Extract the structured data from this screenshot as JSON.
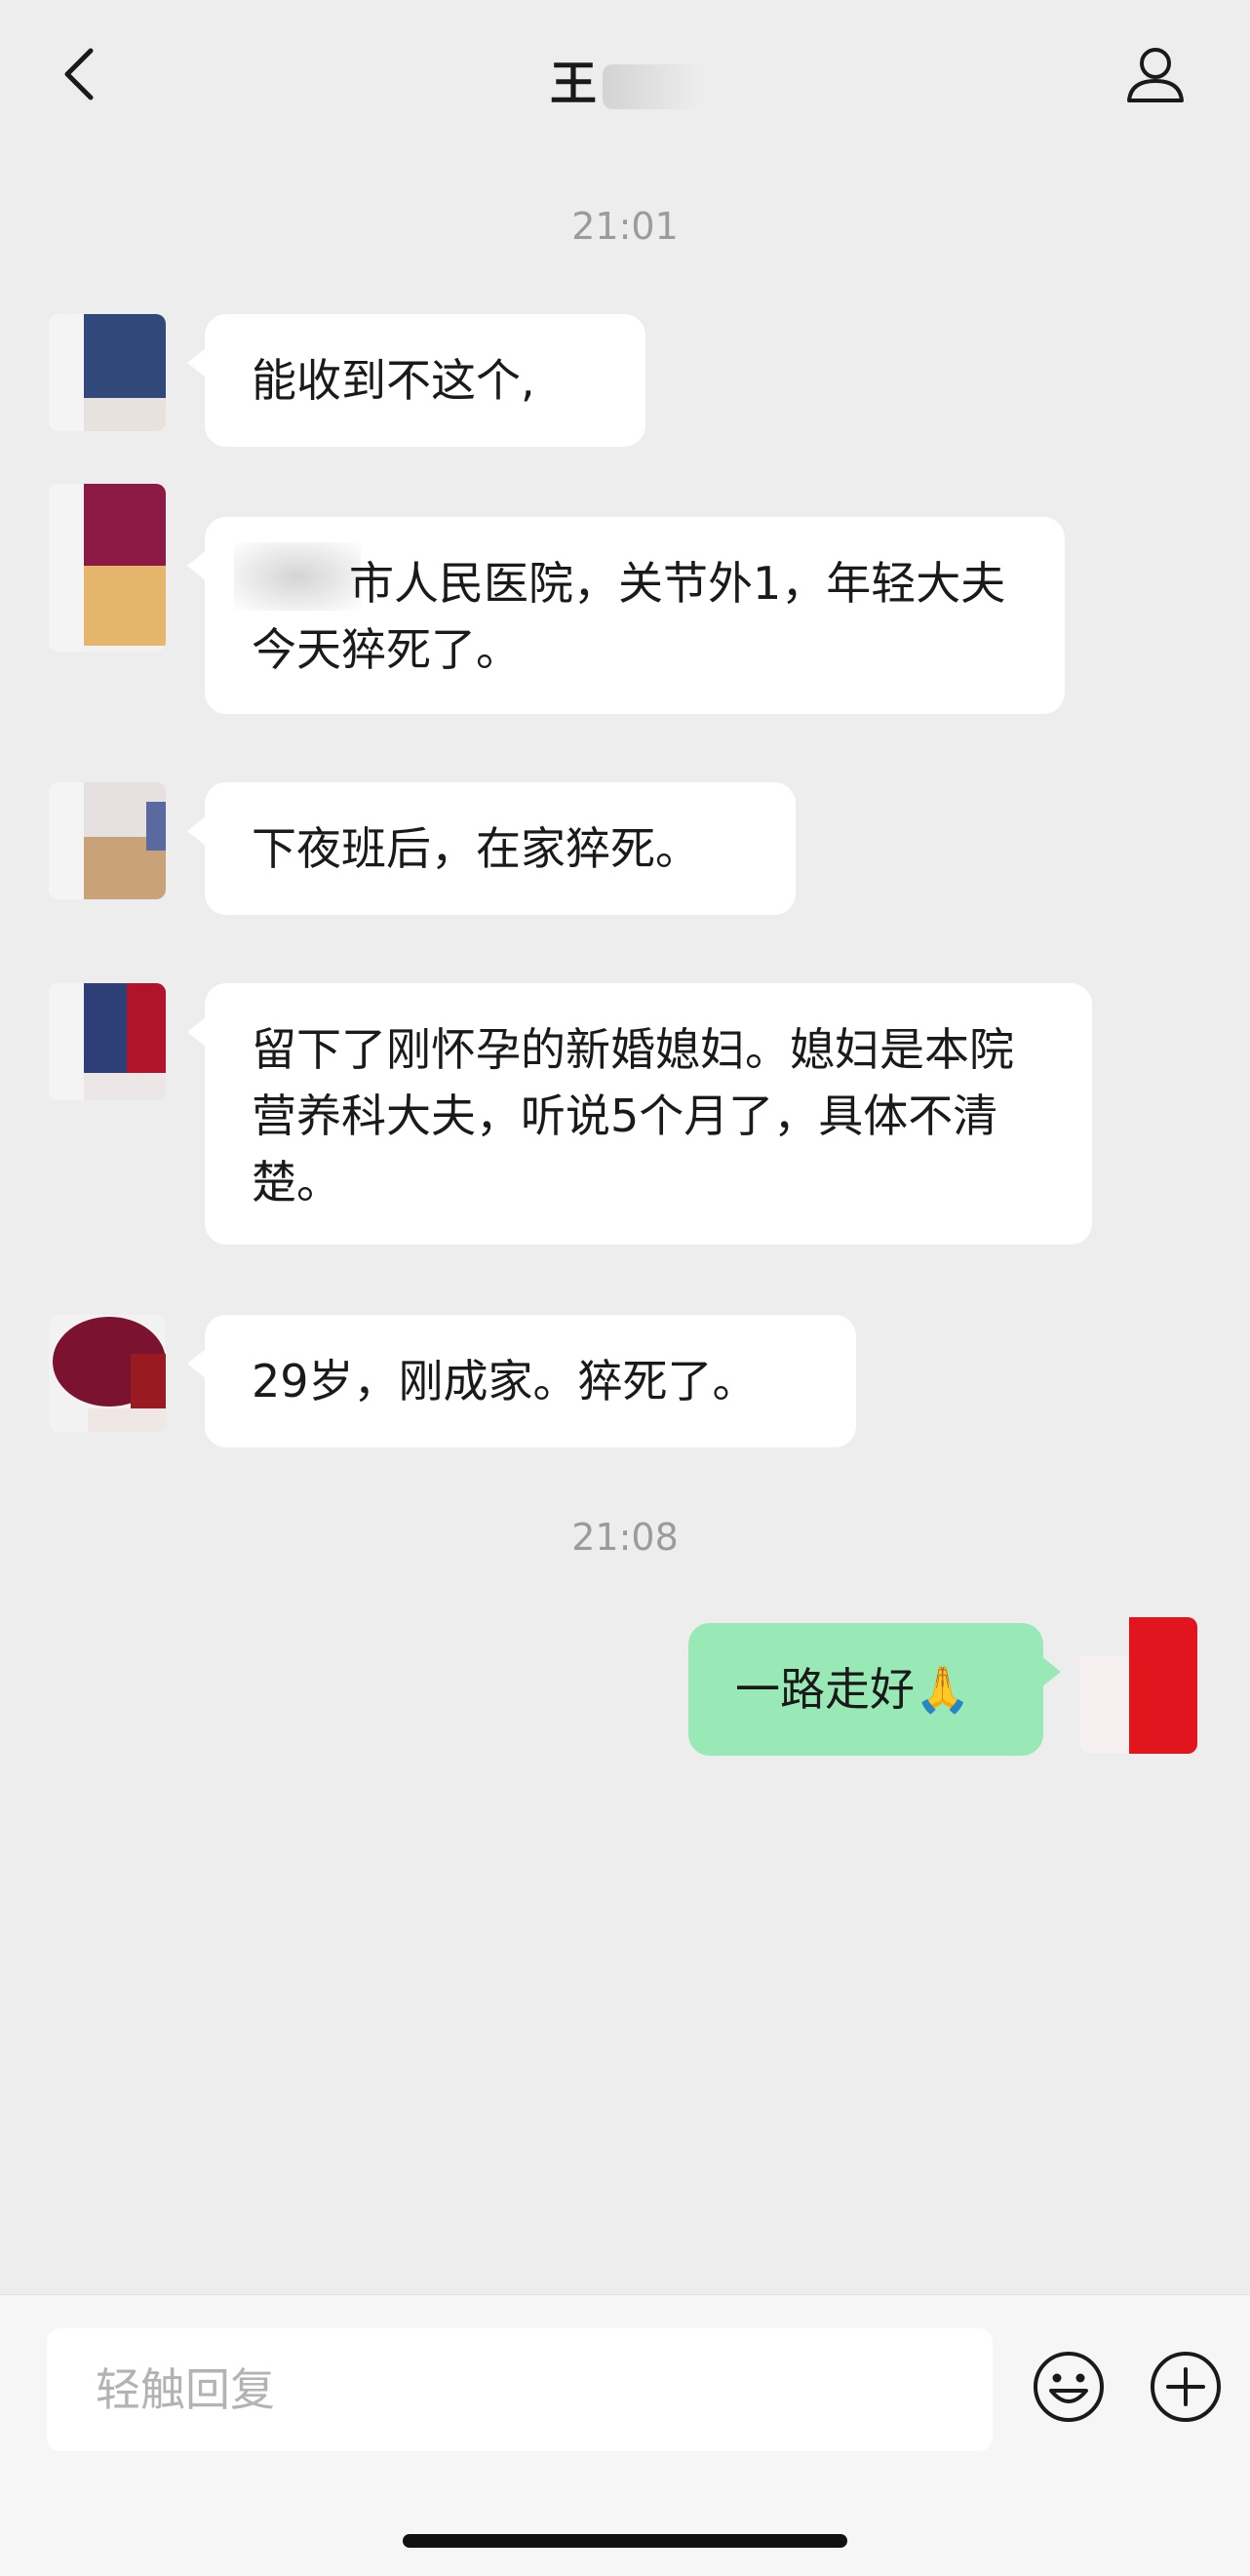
{
  "header": {
    "back_icon": "chevron-left-icon",
    "title": "王",
    "profile_icon": "person-outline-icon"
  },
  "messages": [
    {
      "type": "timestamp",
      "text": "21:01"
    },
    {
      "type": "incoming",
      "text": "能收到不这个,"
    },
    {
      "type": "incoming",
      "text": "市人民医院，关节外1，年轻大夫今天猝死了。"
    },
    {
      "type": "incoming",
      "text": "下夜班后，在家猝死。"
    },
    {
      "type": "incoming",
      "text": "留下了刚怀孕的新婚媳妇。媳妇是本院营养科大夫，听说5个月了，具体不清楚。"
    },
    {
      "type": "incoming",
      "text": "29岁，刚成家。猝死了。"
    },
    {
      "type": "timestamp",
      "text": "21:08"
    },
    {
      "type": "outgoing",
      "text": "一路走好🙏"
    }
  ],
  "input_bar": {
    "placeholder": "轻触回复",
    "emoji_icon": "smiley-face-icon",
    "plus_icon": "plus-circle-icon"
  },
  "colors": {
    "background": "#EDEDED",
    "incoming_bubble": "#FFFFFF",
    "outgoing_bubble": "#98E9B5",
    "timestamp_text": "#9B9B9B"
  }
}
